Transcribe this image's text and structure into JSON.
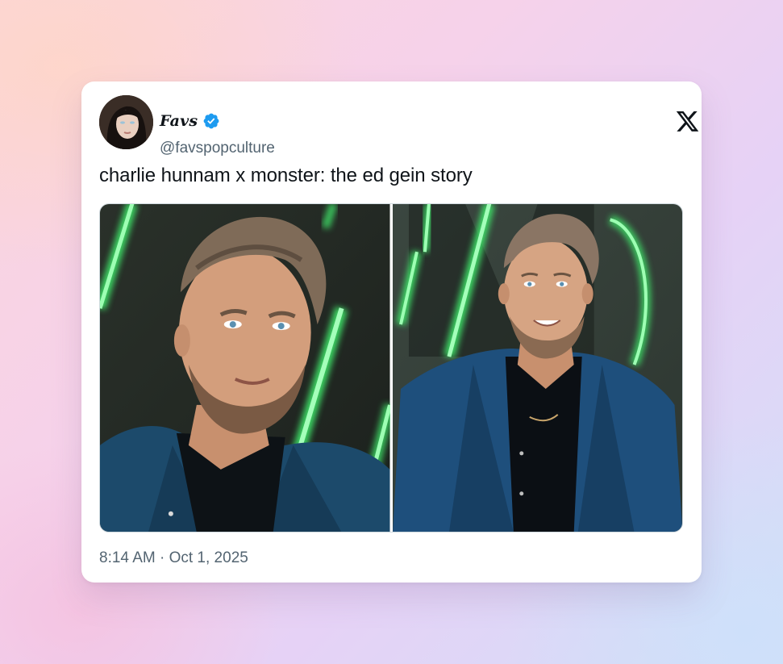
{
  "tweet": {
    "display_name": "Favs",
    "handle": "@favspopculture",
    "verified": true,
    "text": "charlie hunnam x monster: the ed gein story",
    "timestamp": "8:14 AM · Oct 1, 2025"
  },
  "icons": {
    "platform": "x-logo-icon",
    "verified": "verified-badge-icon"
  },
  "colors": {
    "verified_blue": "#1d9bf0",
    "handle_gray": "#536471",
    "text_dark": "#0f1419",
    "neon_green": "#3fe86a"
  },
  "media": [
    {
      "alt": ""
    },
    {
      "alt": ""
    }
  ]
}
